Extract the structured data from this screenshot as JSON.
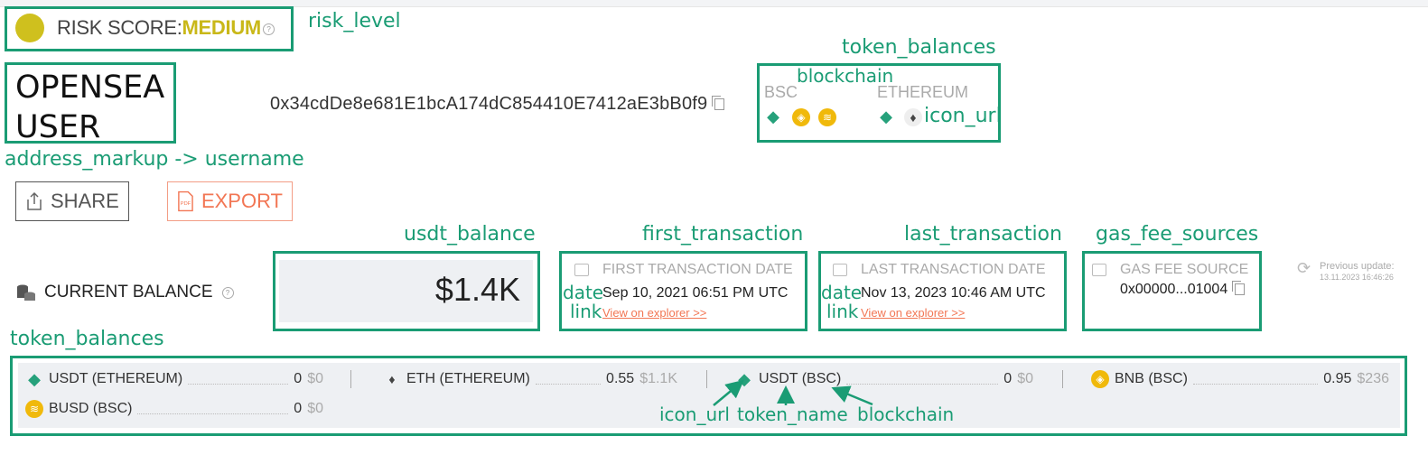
{
  "risk": {
    "label": "RISK SCORE:",
    "level": "MEDIUM",
    "colors": {
      "dot": "#cfc01e",
      "level": "#c9b819"
    }
  },
  "user": {
    "username_line1": "OPENSEA",
    "username_line2": "USER",
    "address": "0x34cdDe8e681E1bcA174dC854410E7412aE3bB0f9"
  },
  "chains": [
    {
      "name": "BSC",
      "icons": [
        "usdt-icon",
        "bnb-icon",
        "busd-icon"
      ]
    },
    {
      "name": "ETHEREUM",
      "icons": [
        "usdt-icon",
        "eth-icon"
      ]
    }
  ],
  "actions": {
    "share": "SHARE",
    "export": "EXPORT"
  },
  "current_balance": {
    "label": "CURRENT BALANCE",
    "value": "$1.4K"
  },
  "first_transaction": {
    "title": "FIRST TRANSACTION DATE",
    "date": "Sep 10, 2021 06:51 PM UTC",
    "link": "View on explorer >>"
  },
  "last_transaction": {
    "title": "LAST TRANSACTION DATE",
    "date": "Nov 13, 2023 10:46 AM UTC",
    "link": "View on explorer >>"
  },
  "gas_fee": {
    "title": "GAS FEE SOURCE",
    "value": "0x00000...01004"
  },
  "previous_update": {
    "label": "Previous update:",
    "timestamp": "13.11.2023 16:46:26"
  },
  "token_balances": [
    {
      "token": "USDT (ETHEREUM)",
      "amount": "0",
      "usd": "$0",
      "icon": "usdt-icon"
    },
    {
      "token": "ETH (ETHEREUM)",
      "amount": "0.55",
      "usd": "$1.1K",
      "icon": "eth-icon"
    },
    {
      "token": "USDT (BSC)",
      "amount": "0",
      "usd": "$0",
      "icon": "usdt-icon"
    },
    {
      "token": "BNB (BSC)",
      "amount": "0.95",
      "usd": "$236",
      "icon": "bnb-icon"
    },
    {
      "token": "BUSD (BSC)",
      "amount": "0",
      "usd": "$0",
      "icon": "busd-icon"
    }
  ],
  "annotations": {
    "risk_level": "risk_level",
    "token_balances_top": "token_balances",
    "blockchain_top": "blockchain",
    "icon_url_top": "icon_url",
    "address_markup": "address_markup -> username",
    "usdt_balance": "usdt_balance",
    "first_transaction": "first_transaction",
    "last_transaction": "last_transaction",
    "gas_fee_sources": "gas_fee_sources",
    "date": "date",
    "link": "link",
    "token_balances_bottom": "token_balances",
    "icon_url_bottom": "icon_url",
    "token_name": "token_name",
    "blockchain_bottom": "blockchain"
  }
}
